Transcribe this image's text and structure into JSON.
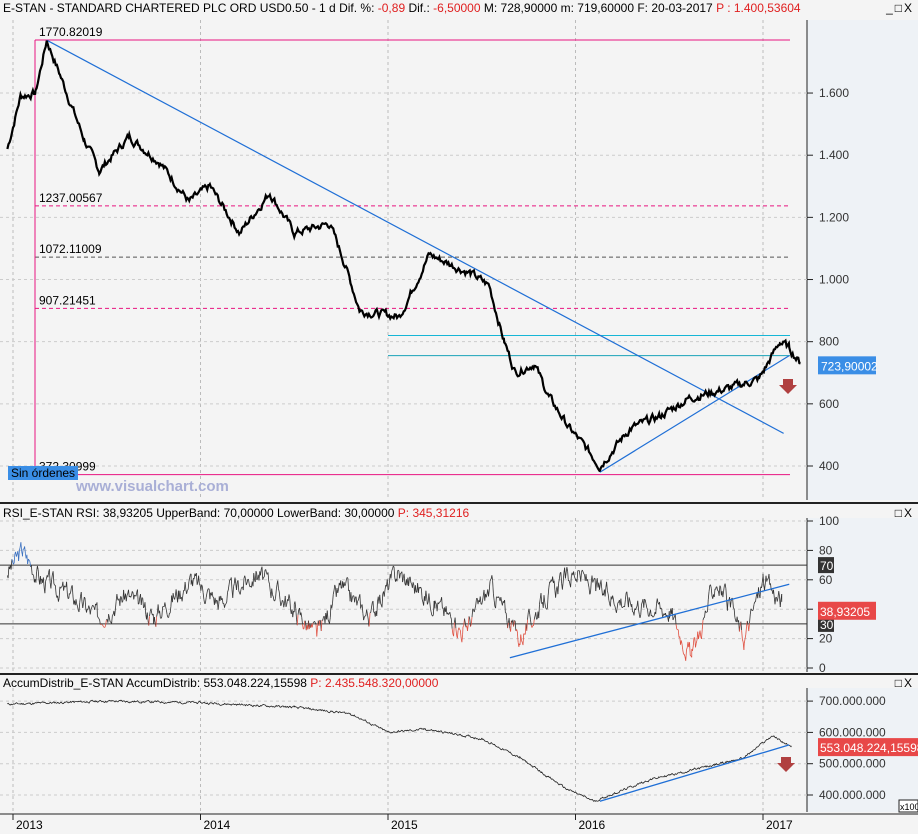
{
  "header": {
    "symbol": "E-STAN - STANDARD CHARTERED PLC ORD USD0.50 -  1 d",
    "dif_pct_label": "Dif. %:",
    "dif_pct": "-0,89",
    "dif_label": "Dif.:",
    "dif": "-6,50000",
    "max": "M: 728,90000",
    "min": "m: 719,60000",
    "date": "F: 20-03-2017",
    "p": "P : 1.400,53604",
    "win_controls": "_□X"
  },
  "rsi_header": {
    "name": "RSI_E-STAN",
    "rsi": "RSI: 38,93205",
    "upper": "UpperBand: 70,00000",
    "lower": "LowerBand: 30,00000",
    "p": "P: 345,31216"
  },
  "ad_header": {
    "name": "AccumDistrib_E-STAN",
    "ad": "AccumDistrib: 553.048.224,15598",
    "p": "P: 2.435.548.320,00000"
  },
  "labels": {
    "no_orders": "Sin órdenes",
    "watermark": "www.visualchart.com",
    "x100": "x100"
  },
  "colors": {
    "fib": "#e8157f",
    "trend": "#1f6fd6",
    "cyan": "#16b6d6",
    "last_price_bg": "#3a8ee6",
    "rsi_bg": "#e84848",
    "arrow": "#b04040"
  },
  "chart_data": [
    {
      "type": "line",
      "title": "E-STAN price",
      "ylim": [
        300,
        1800
      ],
      "yticks": [
        400,
        600,
        800,
        1000,
        1200,
        1400,
        1600
      ],
      "ytick_labels": [
        "400",
        "600",
        "800",
        "1.000",
        "1.200",
        "1.400",
        "1.600"
      ],
      "last_value_label": "723,90002",
      "fib_levels": [
        {
          "value": 1770.82019,
          "label": "1770.82019",
          "style": "solid"
        },
        {
          "value": 1237.00567,
          "label": "1237.00567",
          "style": "dashed"
        },
        {
          "value": 1072.11009,
          "label": "1072.11009",
          "style": "dashed-dark"
        },
        {
          "value": 907.21451,
          "label": "907.21451",
          "style": "dashed"
        },
        {
          "value": 372.30999,
          "label": "372.30999",
          "style": "solid"
        }
      ],
      "hlines": [
        820,
        755
      ],
      "trendlines": [
        [
          [
            2013.18,
            1770
          ],
          [
            2017.11,
            505
          ]
        ],
        [
          [
            2016.13,
            380
          ],
          [
            2017.14,
            755
          ]
        ]
      ],
      "series": [
        [
          2012.97,
          1420
        ],
        [
          2013.04,
          1590
        ],
        [
          2013.12,
          1600
        ],
        [
          2013.18,
          1770
        ],
        [
          2013.25,
          1660
        ],
        [
          2013.38,
          1450
        ],
        [
          2013.46,
          1350
        ],
        [
          2013.62,
          1460
        ],
        [
          2013.78,
          1380
        ],
        [
          2013.94,
          1250
        ],
        [
          2014.05,
          1300
        ],
        [
          2014.21,
          1150
        ],
        [
          2014.37,
          1280
        ],
        [
          2014.5,
          1150
        ],
        [
          2014.69,
          1180
        ],
        [
          2014.77,
          1050
        ],
        [
          2014.85,
          900
        ],
        [
          2015.06,
          880
        ],
        [
          2015.22,
          1080
        ],
        [
          2015.44,
          1020
        ],
        [
          2015.54,
          980
        ],
        [
          2015.62,
          800
        ],
        [
          2015.68,
          700
        ],
        [
          2015.78,
          730
        ],
        [
          2015.86,
          620
        ],
        [
          2015.97,
          520
        ],
        [
          2016.08,
          440
        ],
        [
          2016.13,
          400
        ],
        [
          2016.29,
          520
        ],
        [
          2016.45,
          560
        ],
        [
          2016.61,
          620
        ],
        [
          2016.82,
          650
        ],
        [
          2016.98,
          680
        ],
        [
          2017.09,
          800
        ],
        [
          2017.14,
          780
        ],
        [
          2017.2,
          730
        ]
      ]
    },
    {
      "type": "line",
      "title": "RSI",
      "ylim": [
        0,
        100
      ],
      "yticks": [
        0,
        20,
        40,
        60,
        80,
        100
      ],
      "bands": [
        70,
        30
      ],
      "last_value_label": "38,93205",
      "band_labels": [
        "70",
        "30"
      ],
      "trendlines": [
        [
          [
            2015.65,
            7
          ],
          [
            2017.14,
            57
          ]
        ],
        [
          [
            2015.65,
            7
          ],
          [
            2015.65,
            7
          ]
        ]
      ],
      "series": [
        [
          2012.97,
          65
        ],
        [
          2013.05,
          80
        ],
        [
          2013.15,
          60
        ],
        [
          2013.3,
          50
        ],
        [
          2013.45,
          35
        ],
        [
          2013.6,
          50
        ],
        [
          2013.75,
          35
        ],
        [
          2013.95,
          60
        ],
        [
          2014.1,
          45
        ],
        [
          2014.3,
          65
        ],
        [
          2014.5,
          40
        ],
        [
          2014.62,
          22
        ],
        [
          2014.75,
          55
        ],
        [
          2014.9,
          35
        ],
        [
          2015.05,
          65
        ],
        [
          2015.25,
          45
        ],
        [
          2015.4,
          25
        ],
        [
          2015.55,
          55
        ],
        [
          2015.7,
          20
        ],
        [
          2015.85,
          50
        ],
        [
          2016.0,
          65
        ],
        [
          2016.15,
          50
        ],
        [
          2016.3,
          45
        ],
        [
          2016.5,
          40
        ],
        [
          2016.62,
          7
        ],
        [
          2016.75,
          60
        ],
        [
          2016.9,
          20
        ],
        [
          2017.0,
          60
        ],
        [
          2017.1,
          45
        ]
      ]
    },
    {
      "type": "line",
      "title": "AccumDistrib",
      "ylim": [
        350,
        750
      ],
      "yticks": [
        400,
        500,
        600,
        700
      ],
      "ytick_labels": [
        "400.000.000",
        "500.000.000",
        "600.000.000",
        "700.000.000"
      ],
      "last_value_label": "553.048.224,15598",
      "series": [
        [
          2012.97,
          690
        ],
        [
          2013.5,
          700
        ],
        [
          2014.0,
          695
        ],
        [
          2014.5,
          680
        ],
        [
          2014.8,
          660
        ],
        [
          2015.0,
          600
        ],
        [
          2015.2,
          610
        ],
        [
          2015.5,
          580
        ],
        [
          2015.7,
          520
        ],
        [
          2015.95,
          420
        ],
        [
          2016.1,
          380
        ],
        [
          2016.4,
          450
        ],
        [
          2016.7,
          490
        ],
        [
          2016.9,
          520
        ],
        [
          2017.05,
          590
        ],
        [
          2017.15,
          553
        ]
      ],
      "trendlines": [
        [
          [
            2016.13,
            380
          ],
          [
            2017.14,
            560
          ]
        ]
      ]
    }
  ],
  "xaxis": {
    "labels": [
      "2013",
      "2014",
      "2015",
      "2016",
      "2017"
    ],
    "years": [
      2013,
      2014,
      2015,
      2016,
      2017
    ]
  }
}
